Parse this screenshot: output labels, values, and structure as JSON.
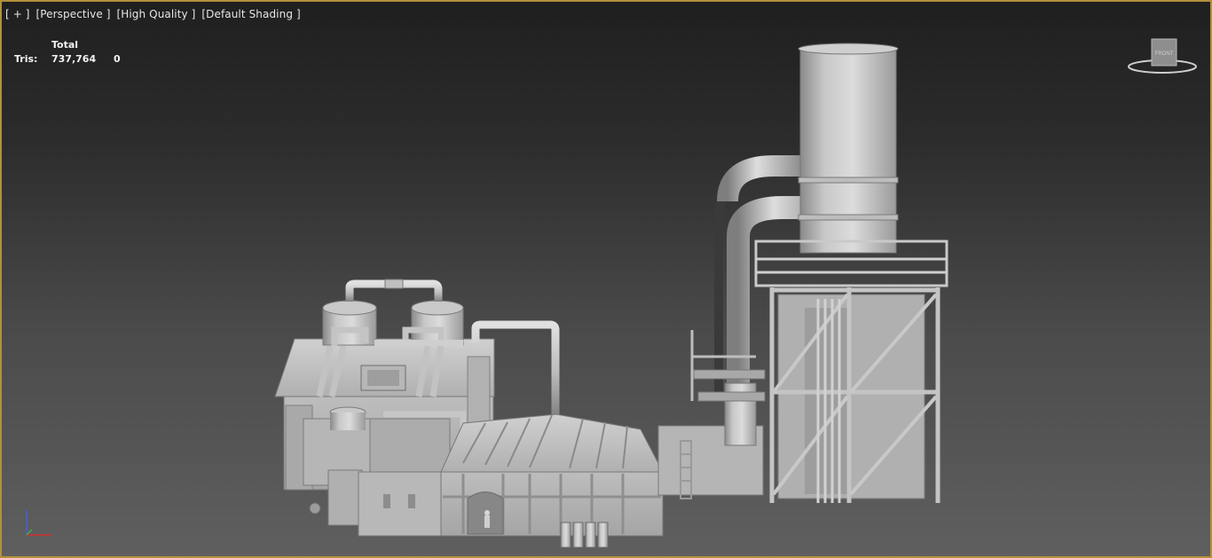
{
  "viewport": {
    "labels": [
      "[ + ]",
      "[Perspective ]",
      "[High Quality ]",
      "[Default Shading ]"
    ]
  },
  "stats": {
    "header": "Total",
    "row_label": "Tris:",
    "total_value": "737,764",
    "selected_value": "0"
  },
  "viewcube": {
    "face_label": "FRONT"
  },
  "colors": {
    "border": "#b3913a",
    "axis_x": "#d03030",
    "axis_y": "#40b040",
    "axis_z": "#3a64e0"
  }
}
